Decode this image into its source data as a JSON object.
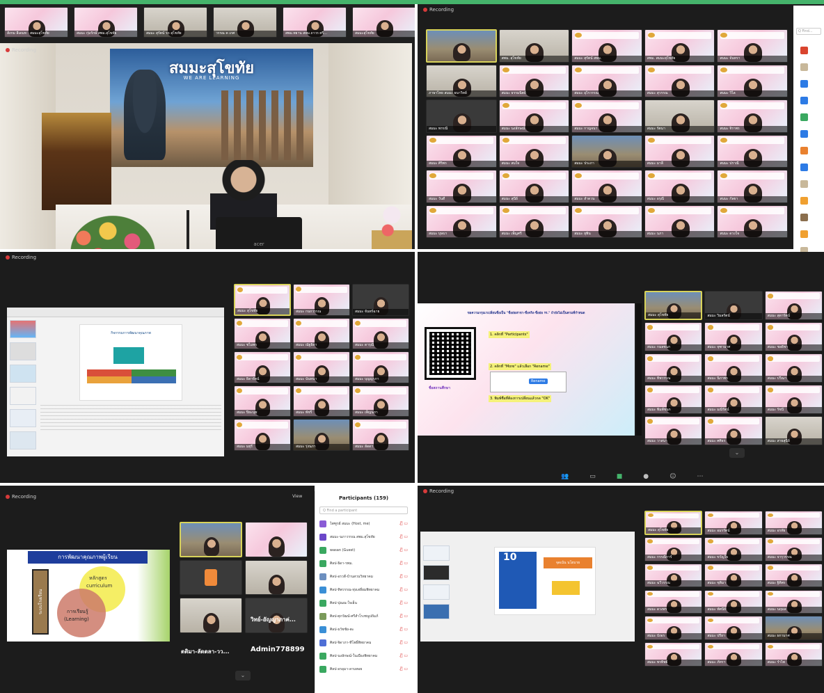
{
  "app": {
    "recording_label": "Recording",
    "view_label": "View"
  },
  "panel_a": {
    "backdrop_title": "สมมะสุโขทัย",
    "backdrop_sub": "WE ARE LEARNING",
    "laptop_brand": "acer",
    "top_strip_names": [
      "สังกม ลีเดมท - สมมะสุโขทัย",
      "สมมะ กุ่มรักษ์ สพม.สุโขทัย",
      "สมมะ สุรัตน์ รถ สุโขทัย",
      "วรรณ ค เกศ",
      "สพม.ทยาน สพม.ถาวร ศรี...",
      "สมมะสุโขทัย"
    ]
  },
  "panel_b": {
    "search_placeholder": "Q Find...",
    "tile_names": [
      "",
      "สพม. สุโขทัย",
      "สมมะ สุรัตน์ สพม.",
      "สพม. สมมะสุโขทัย",
      "สมมะ จันทรา",
      "ภาษาไทย สมมะ ธนาวิทย์",
      "สมมะ ธรรมนิตย์",
      "สมมะ อุไรวรรณ",
      "สมมะ สุวรรณ",
      "สมมะ วิไล",
      "สมมะ พรรณี",
      "สมมะ นงลักษณ์",
      "สมมะ กาญจนา",
      "สมมะ รัตนา",
      "สมมะ จิราพร",
      "สมมะ ศิริพร",
      "สมมะ สมใจ",
      "สมมะ ประภา",
      "สมมะ มาลี",
      "สมมะ ปราณี",
      "สมมะ วันดี",
      "สมมะ สุนีย์",
      "สมมะ ลำดวน",
      "สมมะ อรุณี",
      "สมมะ กัลยา",
      "สมมะ บุษบา",
      "สมมะ เพ็ญศรี",
      "สมมะ ยุพิน",
      "สมมะ นภา",
      "สมมะ ดวงใจ"
    ]
  },
  "panel_c": {
    "slide_heading": "กิจกรรมการพัฒนาคุณภาพ",
    "tile_names": [
      "สมมะ สุโขทัย",
      "สมมะ กนกวรรณ",
      "สมมะ จันทร์ฉาย",
      "สมมะ ชไมพร",
      "สมมะ ณัฐธิดา",
      "สมมะ ดารุณี",
      "สมมะ ธิดารัตน์",
      "สมมะ นันทนา",
      "สมมะ บุญญาภา",
      "สมมะ ปิยะนุช",
      "สมมะ พัชรี",
      "สมมะ เพ็ญนภา",
      "สมมะ มยุรี",
      "สมมะ รุ่งนภา",
      "สมมะ ลัดดา"
    ]
  },
  "panel_d": {
    "slide_title": "ขอความกรุณาเปลี่ยนชื่อเป็น \"ชื่อย่อสาขา-ชื่อจริง-ชื่อย่อ รร.\" ถ้ายังไม่เป็นตามที่กำหนด",
    "step1": "1. คลิกที่ \"Participants\"",
    "step2": "2. คลิกที่ \"More\" แล้วเลือก \"Rename\"",
    "step3": "3. พิมพ์ชื่อที่ต้องการเปลี่ยนแล้วกด \"OK\"",
    "rename_button": "Rename",
    "side_note": "ชื่อสถานศึกษา",
    "tile_names": [
      "สมมะ สุโขทัย",
      "สมมะ วิมลรัตน์",
      "สมมะ สุดารัตน์",
      "สมมะ กมลชนก",
      "สมมะ จุฑามาศ",
      "สมมะ ชลธิชา",
      "สมมะ ทิพวรรณ",
      "สมมะ นิภาพร",
      "สมมะ ปวีณา",
      "สมมะ พิมพ์ชนก",
      "สมมะ มณีรัตน์",
      "สมมะ รัชนี",
      "สมมะ วาสนา",
      "สมมะ ศศิธร",
      "สมมะ สายสุนีย์"
    ]
  },
  "panel_e": {
    "slide_title": "การพัฒนาคุณภาพผู้เรียน",
    "side_label": "ระบบโรงเรียน",
    "circle_top_th": "หลักสูตร",
    "circle_top_en": "curriculum",
    "circle_bottom_th": "การเรียนรู้",
    "circle_bottom_en": "(Learning)",
    "big_name_1": "ตติมา-ลัดดลา-วว...",
    "big_name_2": "Admin778899",
    "big_name_3": "วิทย์-อัญญาภาค่...",
    "participants_title": "Participants (159)",
    "participants_search": "Q Find a participant",
    "participants": [
      "ไพฑูรย์ สมมะ (Host, me)",
      "สมมะ-นภาวรรณ สพม.สุโขทัย",
      "wasan (Guest)",
      "ศิลป-ธิดา-รพม.",
      "ศิลป-อรวดี-บ้านสวนวิทยาคม",
      "ศิลป-ทิพวรรณ-ทุ่งเสลี่ยมพิทยาคม",
      "ศิลป-ปุณณ-ใจเย็น",
      "ศิลป-ศุภวัฒน์-ศรีสำโรงชนูปถัมภ์",
      "ศิลป-ธวัชชัย-ตะ",
      "ศิลป-จิดาภา-ทีโพธิ์พิทยาคม",
      "ศิลป-นงลักษณ์-ในเมืองพิทยาคม",
      "ศิลป-อรอุมา-ลานหอย"
    ]
  },
  "panel_f": {
    "slide_badge": "10",
    "slide_banner": "จุดเน้น นโยบาย",
    "tile_names": [
      "สมมะ สุโขทัย",
      "สมมะ อมรรัตน์",
      "สมมะ อรทัย",
      "สมมะ กรรณิการ์",
      "สมมะ ขวัญใจ",
      "สมมะ จารุวรรณ",
      "สมมะ ฉวีวรรณ",
      "สมมะ ชุติมา",
      "สมมะ ฐิติพร",
      "สมมะ ดวงพร",
      "สมมะ ทัศนีย์",
      "สมมะ นฤมล",
      "สมมะ บังอร",
      "สมมะ ปรียา",
      "สมมะ ผกามาศ",
      "สมมะ พรทิพย์",
      "สมมะ ภัทรา",
      "สมมะ รำไพ"
    ]
  },
  "colors": {
    "accent_green": "#45b36b",
    "zoom_dark": "#1c1c1c",
    "record_red": "#d73a3a",
    "highlight": "#d8d35a"
  }
}
